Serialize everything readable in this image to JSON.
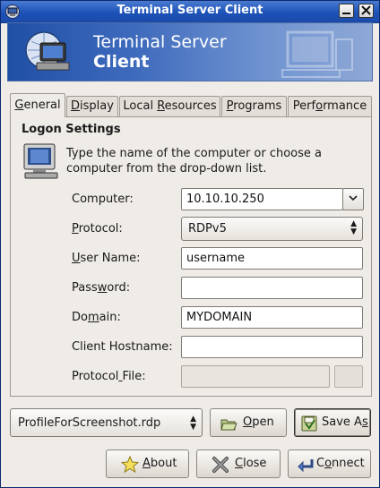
{
  "window": {
    "title": "Terminal Server Client"
  },
  "banner": {
    "title_line1": "Terminal Server",
    "title_line2": "Client"
  },
  "tabs": [
    {
      "label": "General",
      "mnemonic_index": 0
    },
    {
      "label": "Display",
      "mnemonic_index": 0
    },
    {
      "label": "Local Resources",
      "mnemonic_index": 6
    },
    {
      "label": "Programs",
      "mnemonic_index": 0
    },
    {
      "label": "Performance",
      "mnemonic_index": 4
    }
  ],
  "general": {
    "section_title": "Logon Settings",
    "hint": "Type the name of the computer or choose a computer from the drop-down list.",
    "fields": [
      {
        "label": "Computer:",
        "value": "10.10.10.250",
        "kind": "combo-entry"
      },
      {
        "label": "Protocol:",
        "value": "RDPv5",
        "kind": "select"
      },
      {
        "label": "User Name:",
        "value": "username",
        "kind": "entry"
      },
      {
        "label": "Password:",
        "value": "",
        "kind": "entry"
      },
      {
        "label": "Domain:",
        "value": "MYDOMAIN",
        "kind": "entry"
      },
      {
        "label": "Client Hostname:",
        "value": "",
        "kind": "entry"
      },
      {
        "label": "Protocol File:",
        "value": "",
        "kind": "disabled"
      }
    ]
  },
  "profile": {
    "selected": "ProfileForScreenshot.rdp"
  },
  "buttons": {
    "open": "Open",
    "save_as": "Save As",
    "about": "About",
    "close": "Close",
    "connect": "Connect"
  }
}
